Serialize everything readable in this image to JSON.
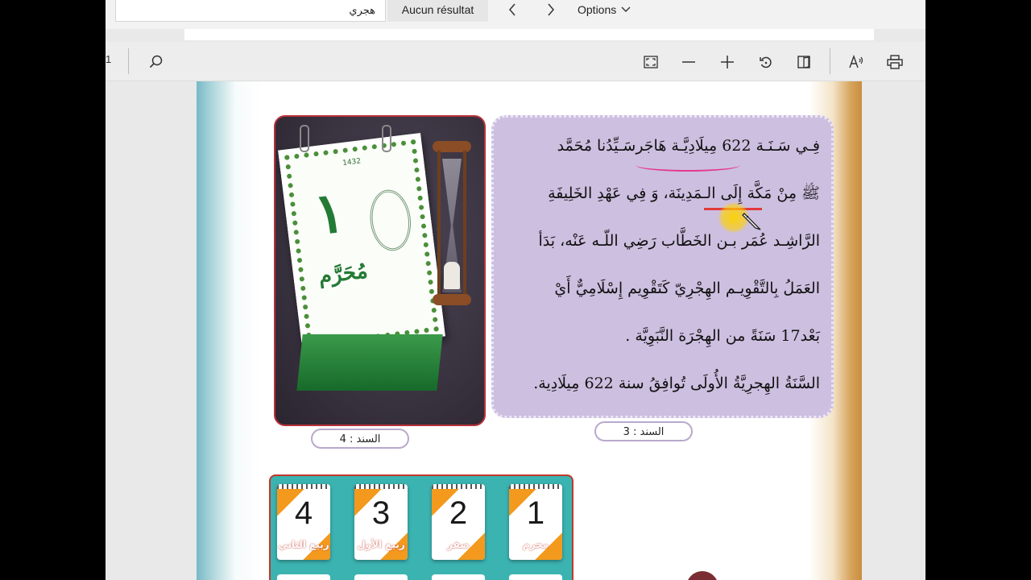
{
  "find_bar": {
    "query": "هجري",
    "result_text": "Aucun résultat",
    "options_label": "Options"
  },
  "toolbar": {
    "page_number": "1"
  },
  "page": {
    "text_block": {
      "lines": [
        "فِـي سَـنَـة 622 مِيلَادِيَّـة هَاجَرسَـيِّدُنا مُحَمَّد",
        "ﷺ مِنْ مَكَّة إِلَى الـمَدِينَة، وَ فِي عَهْدِ الخَلِيفَةِ",
        "الرَّاشِـد عُمَر بـن الخَطَّاب رَضِي اللّـه عَنْه، بَدَأ",
        "العَمَلُ بِالتَّقْوِيـم الهِجْرِيّ كَتَقْوِيم إِسْلَامِيٌّ أَيْ",
        "بَعْد17 سَنَةً من الهِجْرَة النَّبَوِيَّة .",
        "السَّنَةُ الهِجرِيَّةُ الأُولَى تُوافِقُ سنة 622 مِيلَادِية."
      ]
    },
    "captions": {
      "doc3": "السند : 3",
      "doc4": "السند : 4"
    },
    "calendar_photo": {
      "year": "1432",
      "day": "١",
      "month": "مُحَرَّم"
    },
    "months": [
      {
        "number": "4",
        "name": "ربيع الثاني"
      },
      {
        "number": "3",
        "name": "ربيع الأول"
      },
      {
        "number": "2",
        "name": "صفر"
      },
      {
        "number": "1",
        "name": "محرم"
      }
    ]
  },
  "colors": {
    "text_box_bg": "#cdbfe0",
    "month_panel_bg": "#3bb3b1",
    "accent_orange": "#f39a1e",
    "calendar_green": "#237a34"
  },
  "icons": [
    "search-icon",
    "fullscreen-icon",
    "zoom-out-icon",
    "zoom-in-icon",
    "rotate-icon",
    "page-view-icon",
    "read-aloud-icon",
    "print-icon",
    "chevron-left-icon",
    "chevron-right-icon",
    "chevron-down-icon",
    "pencil-cursor-icon"
  ]
}
